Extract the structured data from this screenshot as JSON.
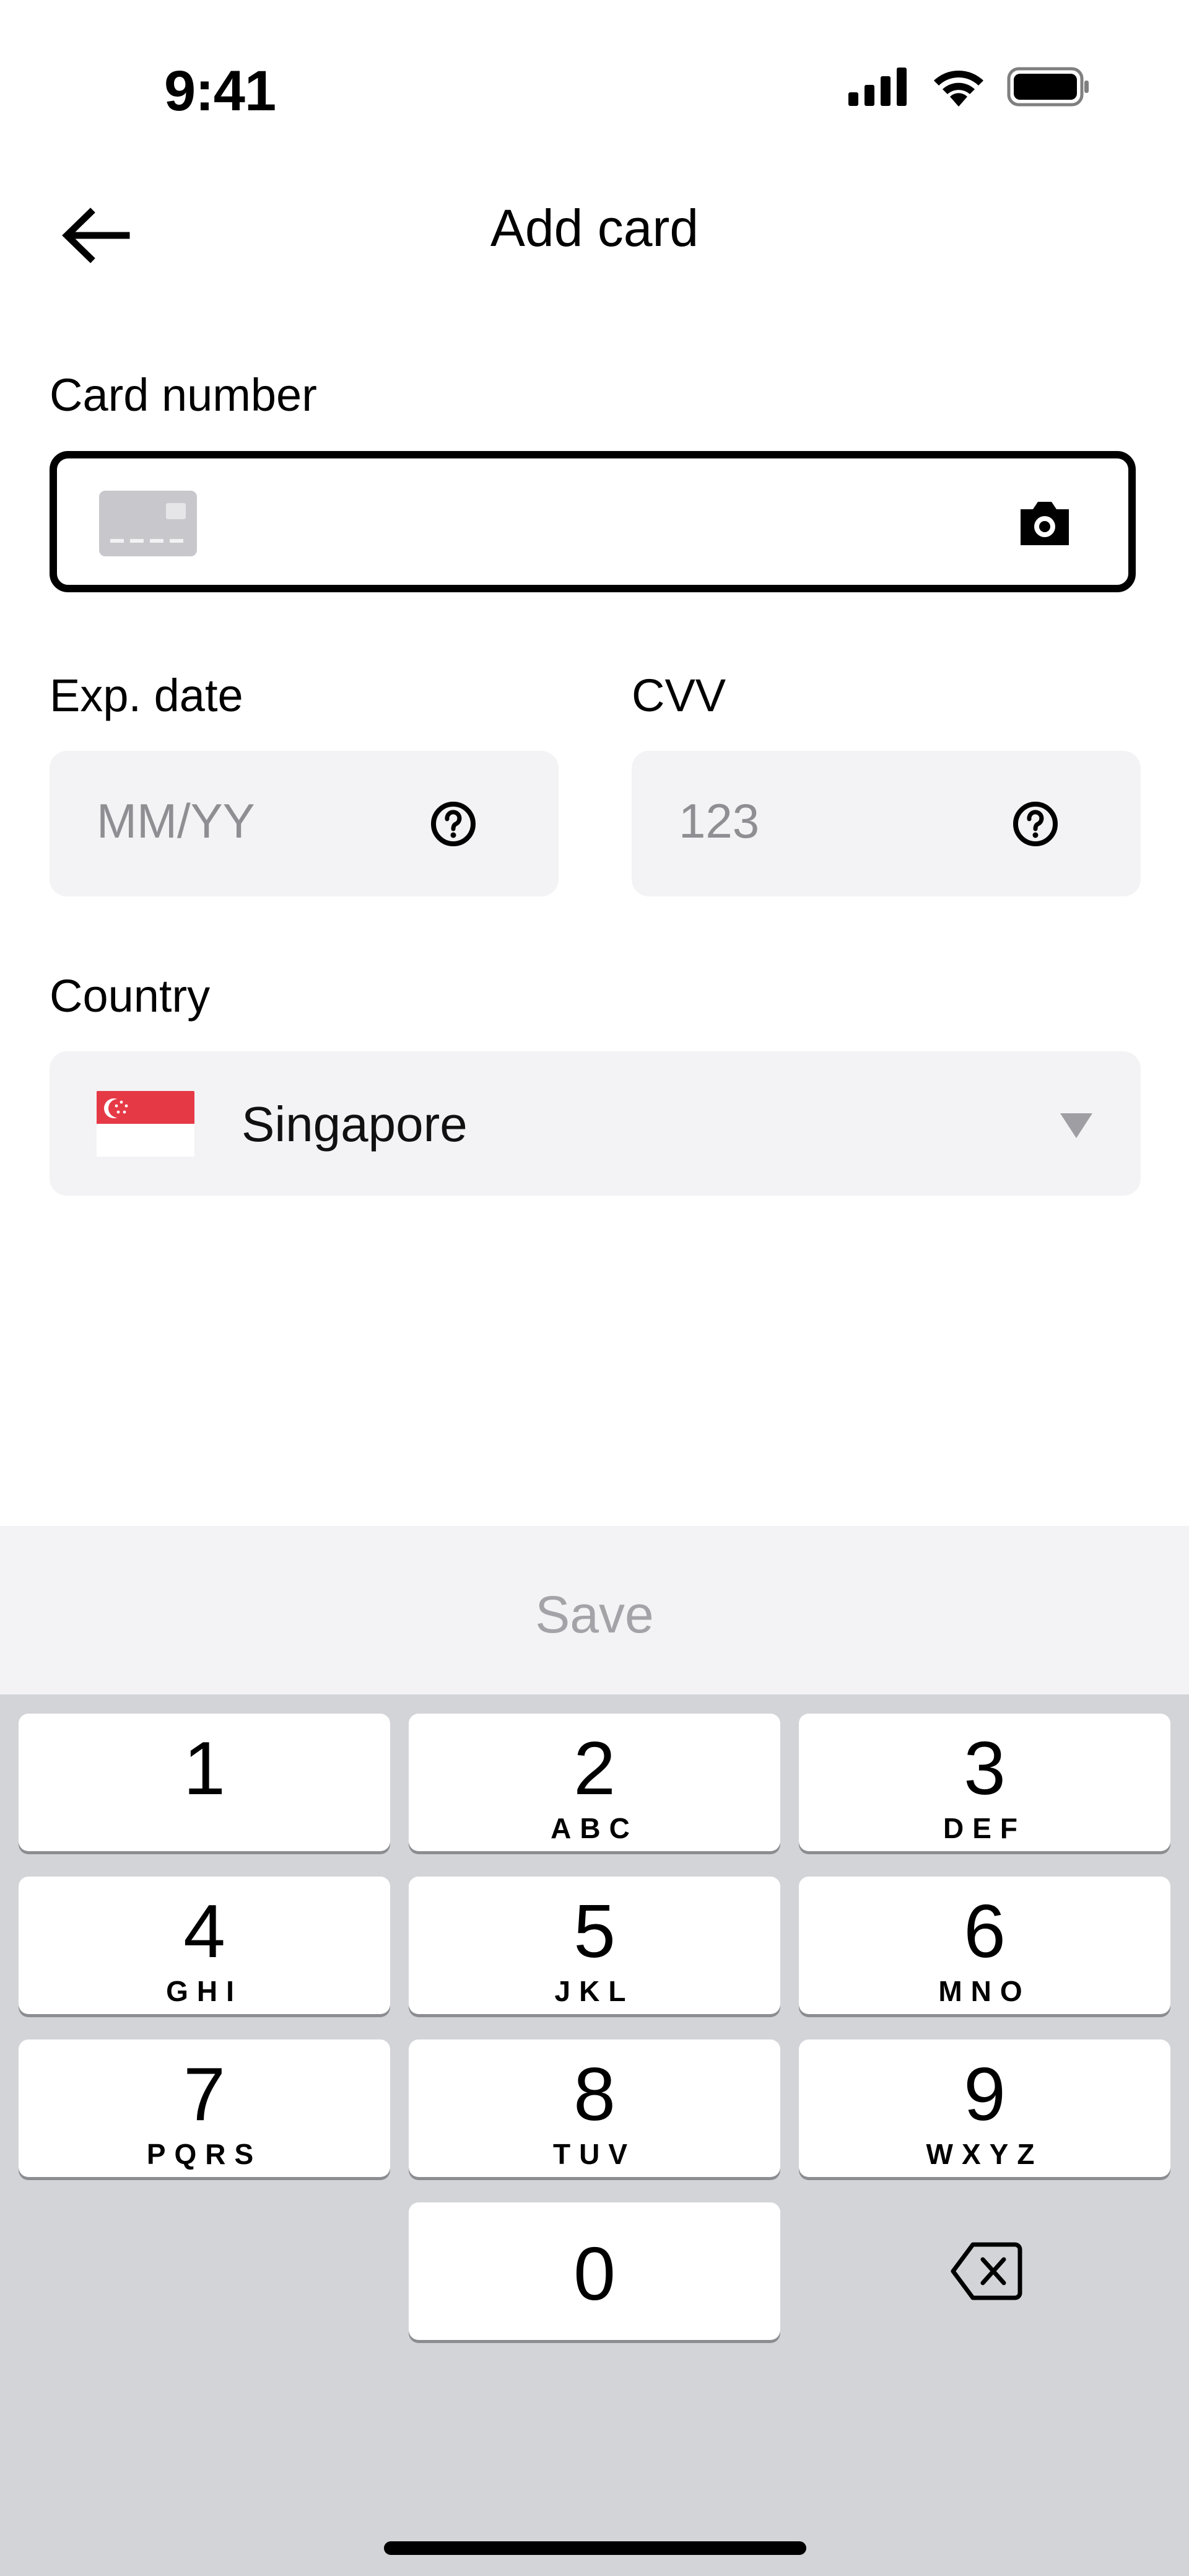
{
  "status_bar": {
    "time": "9:41",
    "icons": [
      "cellular-signal-icon",
      "wifi-icon",
      "battery-icon"
    ]
  },
  "header": {
    "title": "Add card",
    "back_icon": "arrow-left-icon"
  },
  "form": {
    "card_number": {
      "label": "Card number",
      "value": "",
      "icon_left": "card-icon",
      "icon_right": "camera-icon"
    },
    "exp_date": {
      "label": "Exp. date",
      "placeholder": "MM/YY",
      "icon": "help-circle-icon"
    },
    "cvv": {
      "label": "CVV",
      "placeholder": "123",
      "icon": "help-circle-icon"
    },
    "country": {
      "label": "Country",
      "value": "Singapore",
      "flag": "singapore-flag-icon",
      "caret": "caret-down-icon"
    }
  },
  "save_button": {
    "label": "Save",
    "enabled": false
  },
  "keyboard": {
    "keys": [
      {
        "num": "1",
        "letters": ""
      },
      {
        "num": "2",
        "letters": "ABC"
      },
      {
        "num": "3",
        "letters": "DEF"
      },
      {
        "num": "4",
        "letters": "GHI"
      },
      {
        "num": "5",
        "letters": "JKL"
      },
      {
        "num": "6",
        "letters": "MNO"
      },
      {
        "num": "7",
        "letters": "PQRS"
      },
      {
        "num": "8",
        "letters": "TUV"
      },
      {
        "num": "9",
        "letters": "WXYZ"
      },
      {
        "num": "0",
        "letters": ""
      }
    ],
    "delete_icon": "backspace-icon"
  },
  "colors": {
    "field_bg": "#f3f3f5",
    "keyboard_bg": "#d3d4d8",
    "disabled_text": "#a3a3a8",
    "flag_red": "#e63946"
  }
}
